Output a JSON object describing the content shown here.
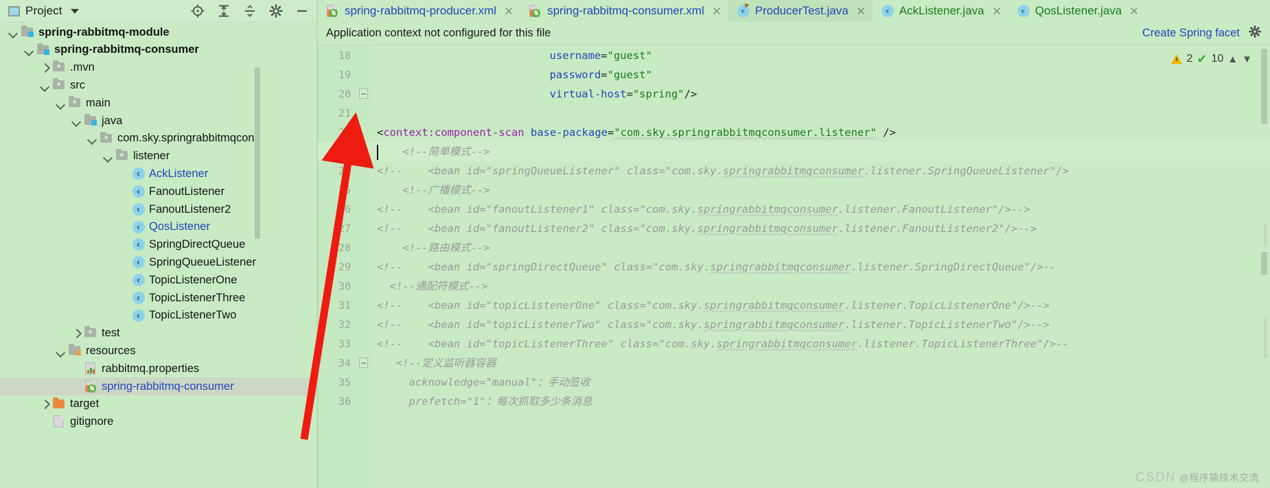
{
  "project_panel": {
    "title": "Project",
    "caret_icon": "chevron-down-icon",
    "window_icon": "project-window-icon",
    "tools": [
      {
        "name": "locate-icon",
        "title": "Select Opened File"
      },
      {
        "name": "expand-all-icon",
        "title": "Expand All"
      },
      {
        "name": "collapse-all-icon",
        "title": "Collapse All"
      },
      {
        "name": "gear-icon",
        "title": "Settings"
      },
      {
        "name": "minimize-icon",
        "title": "Hide"
      }
    ],
    "tree": [
      {
        "label": "spring-rabbitmq-module",
        "indent": 0,
        "arrow": "down",
        "icon": "module-folder-icon",
        "bold": true,
        "selected": false,
        "style": "plain"
      },
      {
        "label": "spring-rabbitmq-consumer",
        "indent": 1,
        "arrow": "down",
        "icon": "module-folder-icon",
        "bold": true,
        "selected": false,
        "style": "plain"
      },
      {
        "label": ".mvn",
        "indent": 2,
        "arrow": "right",
        "icon": "folder-icon",
        "bold": false,
        "selected": false,
        "style": "plain"
      },
      {
        "label": "src",
        "indent": 2,
        "arrow": "down",
        "icon": "folder-icon",
        "bold": false,
        "selected": false,
        "style": "plain"
      },
      {
        "label": "main",
        "indent": 3,
        "arrow": "down",
        "icon": "folder-icon",
        "bold": false,
        "selected": false,
        "style": "plain"
      },
      {
        "label": "java",
        "indent": 4,
        "arrow": "down",
        "icon": "source-folder-icon",
        "bold": false,
        "selected": false,
        "style": "plain"
      },
      {
        "label": "com.sky.springrabbitmqcon",
        "indent": 5,
        "arrow": "down",
        "icon": "package-icon",
        "bold": false,
        "selected": false,
        "style": "plain"
      },
      {
        "label": "listener",
        "indent": 6,
        "arrow": "down",
        "icon": "package-icon",
        "bold": false,
        "selected": false,
        "style": "plain"
      },
      {
        "label": "AckListener",
        "indent": 7,
        "arrow": "none",
        "icon": "java-class-icon",
        "bold": false,
        "selected": false,
        "style": "blue"
      },
      {
        "label": "FanoutListener",
        "indent": 7,
        "arrow": "none",
        "icon": "java-class-icon",
        "bold": false,
        "selected": false,
        "style": "plain"
      },
      {
        "label": "FanoutListener2",
        "indent": 7,
        "arrow": "none",
        "icon": "java-class-icon",
        "bold": false,
        "selected": false,
        "style": "plain"
      },
      {
        "label": "QosListener",
        "indent": 7,
        "arrow": "none",
        "icon": "java-class-icon",
        "bold": false,
        "selected": false,
        "style": "blue"
      },
      {
        "label": "SpringDirectQueue",
        "indent": 7,
        "arrow": "none",
        "icon": "java-class-icon",
        "bold": false,
        "selected": false,
        "style": "plain"
      },
      {
        "label": "SpringQueueListener",
        "indent": 7,
        "arrow": "none",
        "icon": "java-class-icon",
        "bold": false,
        "selected": false,
        "style": "plain"
      },
      {
        "label": "TopicListenerOne",
        "indent": 7,
        "arrow": "none",
        "icon": "java-class-icon",
        "bold": false,
        "selected": false,
        "style": "plain"
      },
      {
        "label": "TopicListenerThree",
        "indent": 7,
        "arrow": "none",
        "icon": "java-class-icon",
        "bold": false,
        "selected": false,
        "style": "plain"
      },
      {
        "label": "TopicListenerTwo",
        "indent": 7,
        "arrow": "none",
        "icon": "java-class-icon",
        "bold": false,
        "selected": false,
        "style": "plain"
      },
      {
        "label": "test",
        "indent": 4,
        "arrow": "right",
        "icon": "folder-icon",
        "bold": false,
        "selected": false,
        "style": "plain"
      },
      {
        "label": "resources",
        "indent": 3,
        "arrow": "down",
        "icon": "resources-folder-icon",
        "bold": false,
        "selected": false,
        "style": "plain"
      },
      {
        "label": "rabbitmq.properties",
        "indent": 4,
        "arrow": "none",
        "icon": "properties-file-icon",
        "bold": false,
        "selected": false,
        "style": "plain"
      },
      {
        "label": "spring-rabbitmq-consumer",
        "indent": 4,
        "arrow": "none",
        "icon": "spring-xml-file-icon",
        "bold": false,
        "selected": true,
        "style": "blue"
      },
      {
        "label": "target",
        "indent": 2,
        "arrow": "right",
        "icon": "target-folder-icon",
        "bold": false,
        "selected": false,
        "style": "plain"
      },
      {
        "label": "gitignore",
        "indent": 2,
        "arrow": "none",
        "icon": "file-icon",
        "bold": false,
        "selected": false,
        "style": "plain"
      }
    ]
  },
  "tabs": [
    {
      "label": "spring-rabbitmq-producer.xml",
      "icon": "spring-xml-file-icon",
      "active": false,
      "closable": true,
      "color": "blue"
    },
    {
      "label": "spring-rabbitmq-consumer.xml",
      "icon": "spring-xml-file-icon",
      "active": false,
      "closable": true,
      "color": "blue"
    },
    {
      "label": "ProducerTest.java",
      "icon": "java-test-class-icon",
      "active": true,
      "closable": true,
      "color": "blue"
    },
    {
      "label": "AckListener.java",
      "icon": "java-class-icon",
      "active": false,
      "closable": true,
      "color": "green"
    },
    {
      "label": "QosListener.java",
      "icon": "java-class-icon",
      "active": false,
      "closable": true,
      "color": "green"
    }
  ],
  "notification": {
    "message": "Application context not configured for this file",
    "action_label": "Create Spring facet",
    "gear_icon": "gear-icon"
  },
  "inspection": {
    "warning_icon": "warning-triangle-icon",
    "warning_count": "2",
    "check_icon": "inspection-check-icon",
    "check_count": "10",
    "prev_icon": "chevron-up-icon",
    "next_icon": "chevron-down-icon"
  },
  "editor": {
    "first_line_number": 18,
    "lines": [
      {
        "num": "18",
        "indent": 27,
        "segs": [
          {
            "t": "username",
            "c": "k-attr"
          },
          {
            "t": "=",
            "c": "k-punct"
          },
          {
            "t": "\"guest\"",
            "c": "k-str"
          }
        ]
      },
      {
        "num": "19",
        "indent": 27,
        "segs": [
          {
            "t": "password",
            "c": "k-attr"
          },
          {
            "t": "=",
            "c": "k-punct"
          },
          {
            "t": "\"guest\"",
            "c": "k-str"
          }
        ]
      },
      {
        "num": "20",
        "indent": 27,
        "gutter": "fold",
        "segs": [
          {
            "t": "virtual-host",
            "c": "k-attr"
          },
          {
            "t": "=",
            "c": "k-punct"
          },
          {
            "t": "\"spring\"",
            "c": "k-str"
          },
          {
            "t": "/>",
            "c": "k-punct"
          }
        ]
      },
      {
        "num": "21",
        "indent": 0,
        "segs": []
      },
      {
        "num": "22",
        "indent": 0,
        "gutter": "spring",
        "segs": [
          {
            "t": "<",
            "c": "k-punct"
          },
          {
            "t": "context:component-scan",
            "c": "k-tag"
          },
          {
            "t": " ",
            "c": "k-punct"
          },
          {
            "t": "base-package",
            "c": "k-attr"
          },
          {
            "t": "=",
            "c": "k-punct"
          },
          {
            "t": "\"com.sky.springrabbitmqconsumer.listener\"",
            "c": "k-str wavy"
          },
          {
            "t": " />",
            "c": "k-punct"
          }
        ]
      },
      {
        "num": "23",
        "indent": 4,
        "current": true,
        "segs": [
          {
            "t": "<!--简单模式-->",
            "c": "k-cmt"
          }
        ]
      },
      {
        "num": "24",
        "indent": 0,
        "segs": [
          {
            "t": "<!--    <bean id=\"springQueueListener\" class=\"com.sky.",
            "c": "k-cmt"
          },
          {
            "t": "springrabbitmqconsumer",
            "c": "k-cmt wavy"
          },
          {
            "t": ".listener.SpringQueueListener\"/>",
            "c": "k-cmt"
          }
        ]
      },
      {
        "num": "25",
        "indent": 4,
        "segs": [
          {
            "t": "<!--广播模式-->",
            "c": "k-cmt"
          }
        ]
      },
      {
        "num": "26",
        "indent": 0,
        "segs": [
          {
            "t": "<!--    <bean id=\"fanoutListener1\" class=\"com.sky.",
            "c": "k-cmt"
          },
          {
            "t": "springrabbitmqconsumer",
            "c": "k-cmt wavy"
          },
          {
            "t": ".listener.FanoutListener\"/>-->",
            "c": "k-cmt"
          }
        ]
      },
      {
        "num": "27",
        "indent": 0,
        "segs": [
          {
            "t": "<!--    <bean id=\"fanoutListener2\" class=\"com.sky.",
            "c": "k-cmt"
          },
          {
            "t": "springrabbitmqconsumer",
            "c": "k-cmt wavy"
          },
          {
            "t": ".listener.FanoutListener2\"/>-->",
            "c": "k-cmt"
          }
        ]
      },
      {
        "num": "28",
        "indent": 4,
        "segs": [
          {
            "t": "<!--路由模式-->",
            "c": "k-cmt"
          }
        ]
      },
      {
        "num": "29",
        "indent": 0,
        "segs": [
          {
            "t": "<!--    <bean id=\"springDirectQueue\" class=\"com.sky.",
            "c": "k-cmt"
          },
          {
            "t": "springrabbitmqconsumer",
            "c": "k-cmt wavy"
          },
          {
            "t": ".listener.SpringDirectQueue\"/>--",
            "c": "k-cmt"
          }
        ]
      },
      {
        "num": "30",
        "indent": 2,
        "segs": [
          {
            "t": "<!--通配符模式-->",
            "c": "k-cmt"
          }
        ]
      },
      {
        "num": "31",
        "indent": 0,
        "segs": [
          {
            "t": "<!--    <bean id=\"topicListenerOne\" class=\"com.sky.",
            "c": "k-cmt"
          },
          {
            "t": "springrabbitmqconsumer",
            "c": "k-cmt wavy"
          },
          {
            "t": ".listener.TopicListenerOne\"/>-->",
            "c": "k-cmt"
          }
        ]
      },
      {
        "num": "32",
        "indent": 0,
        "segs": [
          {
            "t": "<!--    <bean id=\"topicListenerTwo\" class=\"com.sky.",
            "c": "k-cmt"
          },
          {
            "t": "springrabbitmqconsumer",
            "c": "k-cmt wavy"
          },
          {
            "t": ".listener.TopicListenerTwo\"/>-->",
            "c": "k-cmt"
          }
        ]
      },
      {
        "num": "33",
        "indent": 0,
        "segs": [
          {
            "t": "<!--    <bean id=\"topicListenerThree\" class=\"com.sky.",
            "c": "k-cmt"
          },
          {
            "t": "springrabbitmqconsumer",
            "c": "k-cmt wavy"
          },
          {
            "t": ".listener.TopicListenerThree\"/>--",
            "c": "k-cmt"
          }
        ]
      },
      {
        "num": "34",
        "indent": 3,
        "gutter": "fold",
        "segs": [
          {
            "t": "<!--定义监听器容器",
            "c": "k-cmt"
          }
        ]
      },
      {
        "num": "35",
        "indent": 5,
        "segs": [
          {
            "t": "acknowledge=\"manual\"：手动签收",
            "c": "k-cmt"
          }
        ]
      },
      {
        "num": "36",
        "indent": 5,
        "segs": [
          {
            "t": "prefetch=\"1\"：每次抓取多少条消息",
            "c": "k-cmt"
          }
        ]
      }
    ]
  },
  "annotation": {
    "arrow_color": "#ee1b11",
    "arrow_name": "red-annotation-arrow"
  },
  "watermark": {
    "text": "@程序猿技术交流",
    "prefix": "CSDN"
  }
}
